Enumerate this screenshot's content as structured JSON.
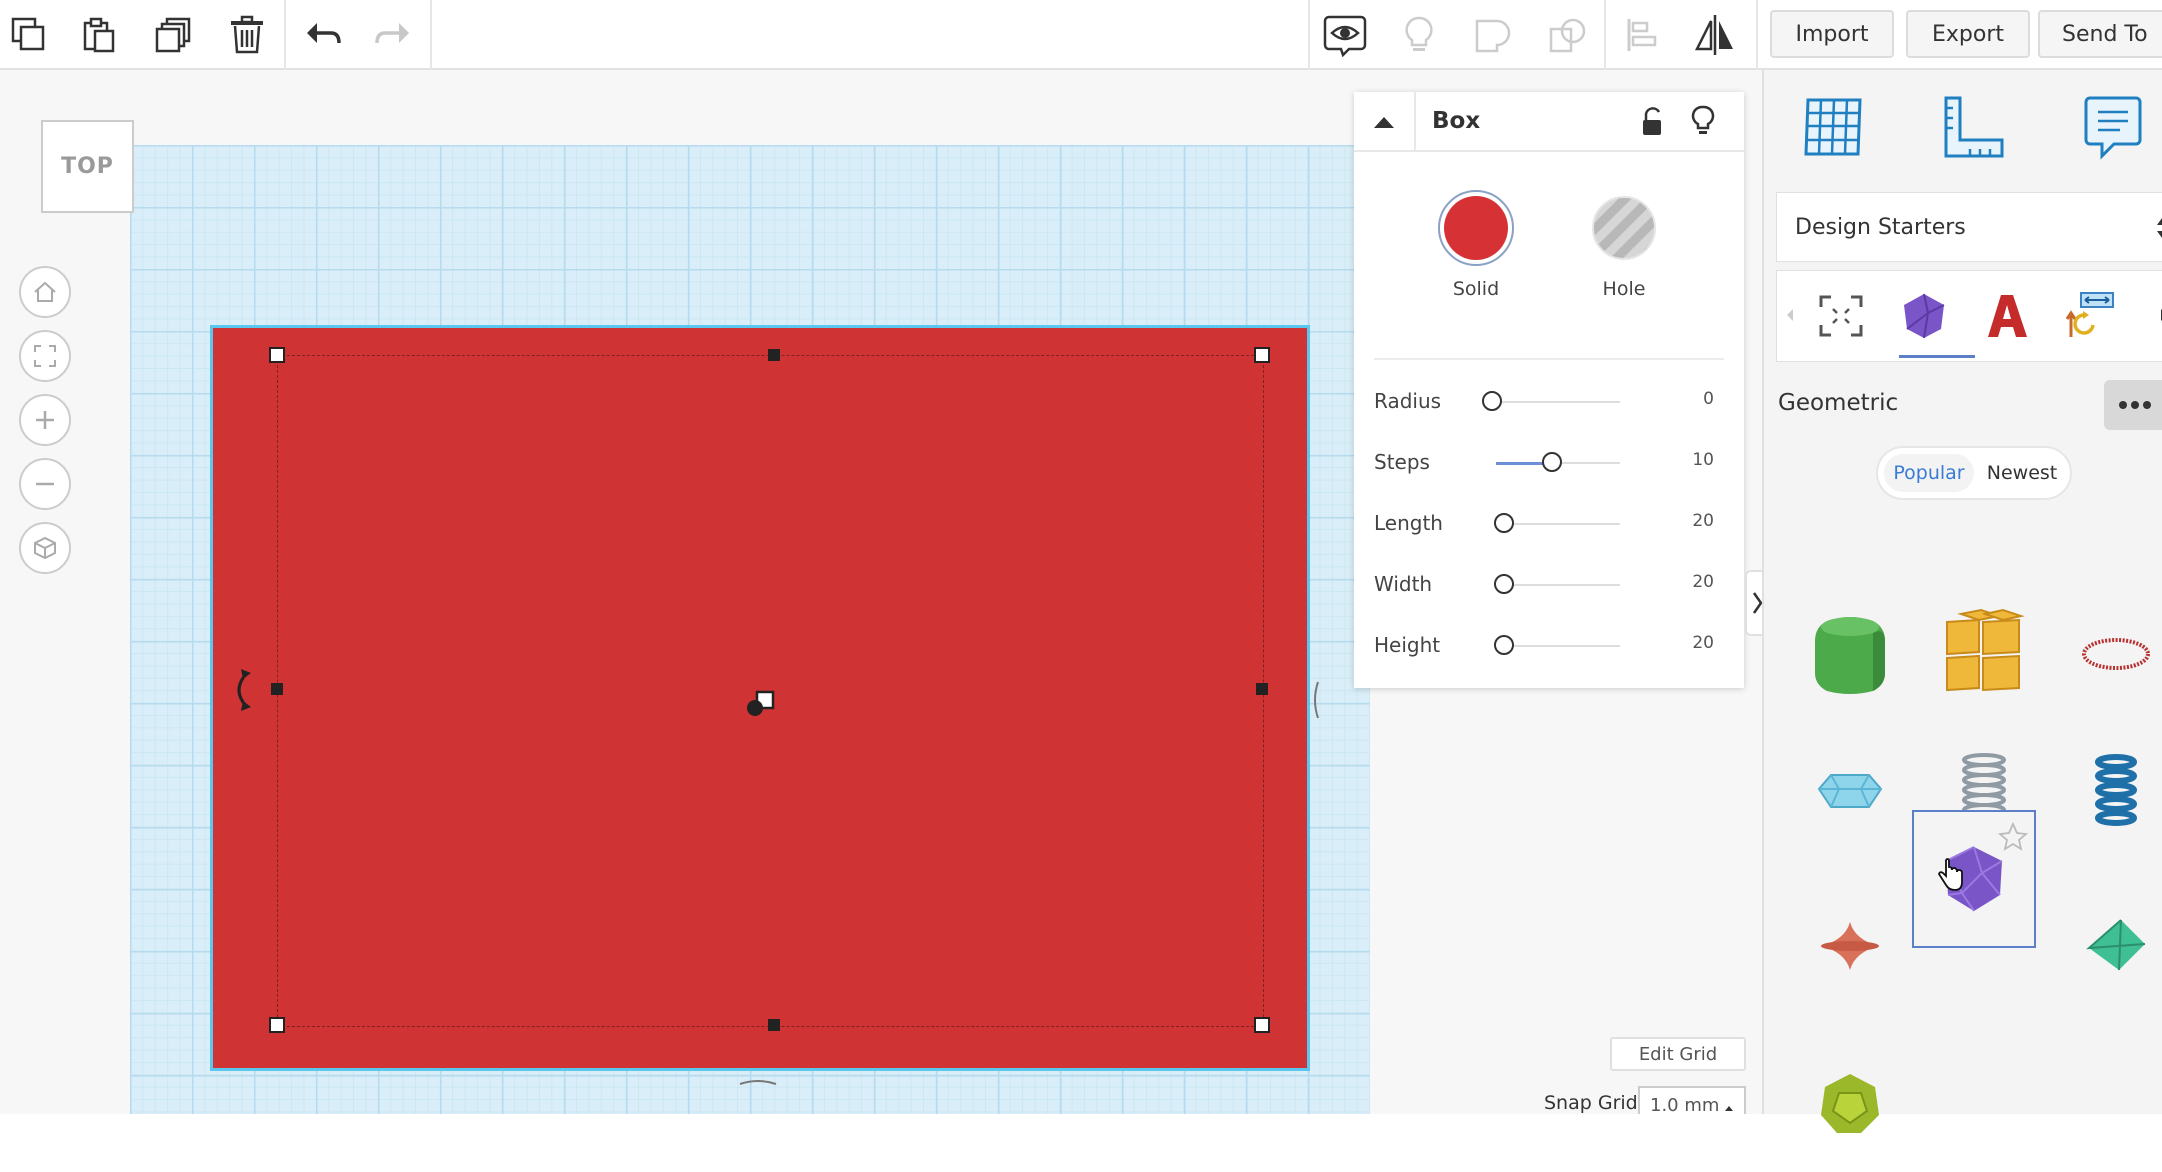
{
  "toolbar": {
    "left_icons": [
      "copy-icon",
      "paste-icon",
      "duplicate-icon",
      "trash-icon",
      "undo-icon",
      "redo-icon"
    ],
    "right_icons": [
      "eye-icon",
      "lightbulb-icon",
      "group-icon",
      "ungroup-icon",
      "align-icon",
      "mirror-icon"
    ],
    "import_label": "Import",
    "export_label": "Export",
    "send_to_label": "Send To"
  },
  "viewcube": {
    "label": "TOP"
  },
  "nav_buttons": [
    "home-icon",
    "fit-view-icon",
    "zoom-in-icon",
    "zoom-out-icon",
    "perspective-icon"
  ],
  "inspector": {
    "title": "Box",
    "solid_label": "Solid",
    "hole_label": "Hole",
    "solid_color": "#d63236",
    "params": [
      {
        "label": "Radius",
        "value": "0",
        "fraction": 0.0
      },
      {
        "label": "Steps",
        "value": "10",
        "fraction": 0.45
      },
      {
        "label": "Length",
        "value": "20",
        "fraction": 0.0
      },
      {
        "label": "Width",
        "value": "20",
        "fraction": 0.0
      },
      {
        "label": "Height",
        "value": "20",
        "fraction": 0.0
      }
    ]
  },
  "grid_controls": {
    "edit_grid_label": "Edit Grid",
    "snap_grid_label": "Snap Grid",
    "snap_grid_value": "1.0 mm"
  },
  "right_panel": {
    "view_icons": [
      "grid-view-icon",
      "ruler-icon",
      "notes-icon"
    ],
    "library_select": "Design Starters",
    "category_tabs": [
      "selection-frame-icon",
      "geometric-shape-icon",
      "text-icon",
      "transform-icon"
    ],
    "section_title": "Geometric",
    "filter_tabs": [
      "Popular",
      "Newest"
    ],
    "shapes": [
      "rounded-cube-icon",
      "yellow-cubes-icon",
      "ring-icon",
      "gem-icon",
      "spring-gray-icon",
      "spring-blue-icon",
      "spindle-icon",
      "icosahedron-icon",
      "pyramid-icon",
      "dodecahedron-icon"
    ]
  },
  "colors": {
    "box_fill": "#cf3333",
    "selection_outline": "#5ac8ee",
    "accent": "#6c8fd8"
  }
}
